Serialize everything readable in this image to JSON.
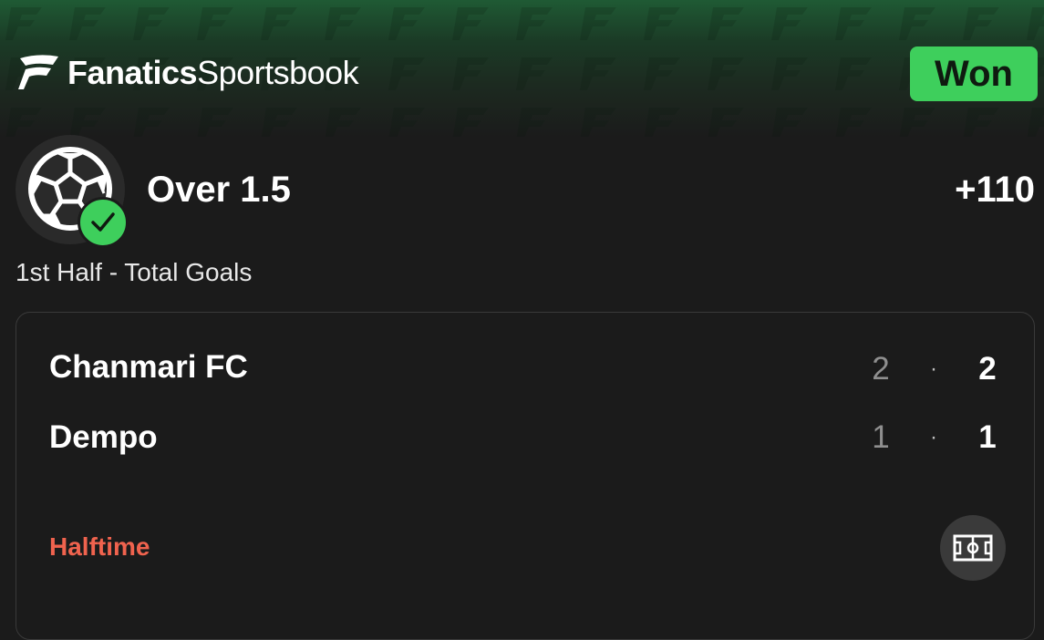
{
  "header": {
    "brand_bold": "Fanatics",
    "brand_light": "Sportsbook",
    "logo_icon": "fanatics-flag-icon",
    "status_badge": "Won",
    "status_color": "#3ecf5c"
  },
  "bet": {
    "sport_icon": "soccer-ball-icon",
    "result_icon": "checkmark-icon",
    "selection": "Over 1.5",
    "odds": "+110",
    "market": "1st Half - Total Goals"
  },
  "match": {
    "teams": [
      {
        "name": "Chanmari FC",
        "score_secondary": "2",
        "separator": "·",
        "score": "2"
      },
      {
        "name": "Dempo",
        "score_secondary": "1",
        "separator": "·",
        "score": "1"
      }
    ],
    "status": "Halftime",
    "status_color": "#f0634e",
    "pitch_icon": "soccer-pitch-icon"
  }
}
